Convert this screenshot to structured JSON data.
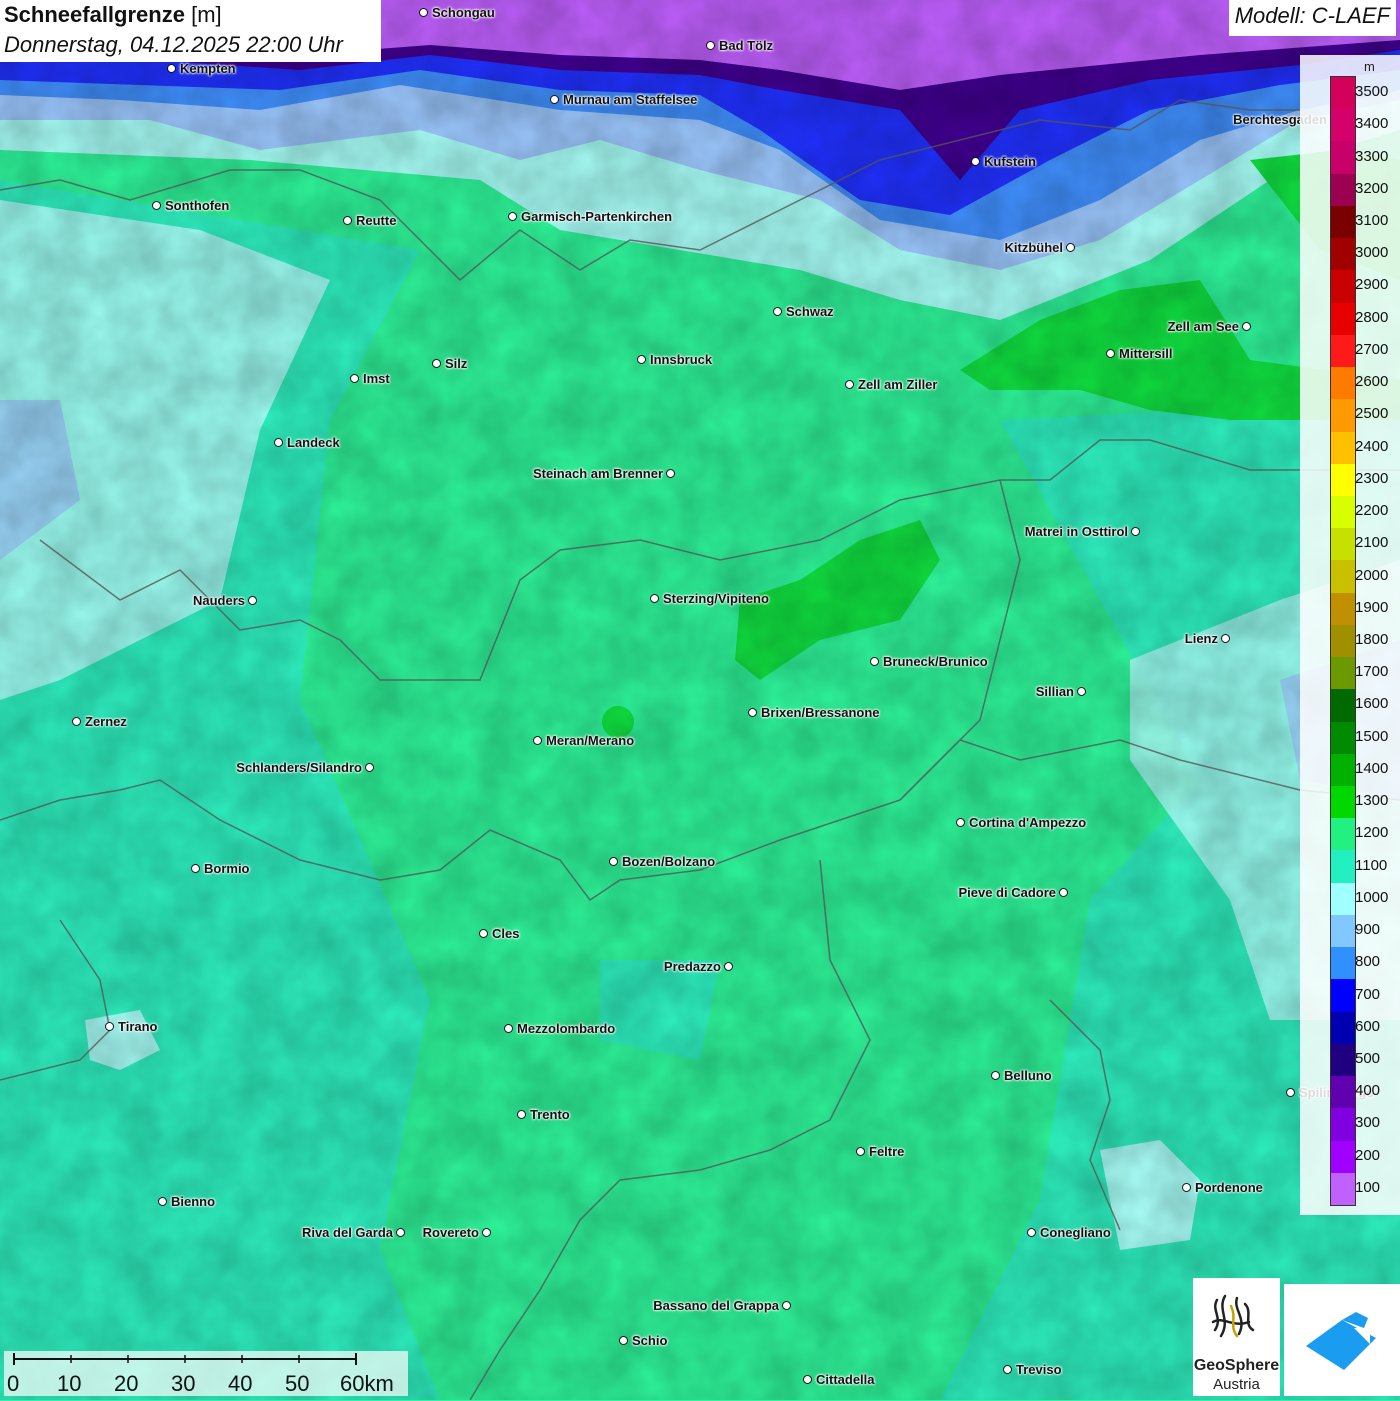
{
  "header": {
    "title": "Schneefallgrenze",
    "unit": "[m]",
    "datetime": "Donnerstag, 04.12.2025 22:00 Uhr",
    "model": "Modell: C-LAEF"
  },
  "legend": {
    "unit": "m",
    "entries": [
      {
        "label": "3500",
        "color": "#d4005a"
      },
      {
        "label": "3400",
        "color": "#d6006b"
      },
      {
        "label": "3300",
        "color": "#c8006a"
      },
      {
        "label": "3200",
        "color": "#9c0050"
      },
      {
        "label": "3100",
        "color": "#7a0000"
      },
      {
        "label": "3000",
        "color": "#a00000"
      },
      {
        "label": "2900",
        "color": "#c80000"
      },
      {
        "label": "2800",
        "color": "#e60000"
      },
      {
        "label": "2700",
        "color": "#ff1a1a"
      },
      {
        "label": "2600",
        "color": "#ff7a00"
      },
      {
        "label": "2500",
        "color": "#ff9a00"
      },
      {
        "label": "2400",
        "color": "#ffc000"
      },
      {
        "label": "2300",
        "color": "#ffff00"
      },
      {
        "label": "2200",
        "color": "#d8ff00"
      },
      {
        "label": "2100",
        "color": "#c8e000"
      },
      {
        "label": "2000",
        "color": "#c8c000"
      },
      {
        "label": "1900",
        "color": "#c09000"
      },
      {
        "label": "1800",
        "color": "#a09000"
      },
      {
        "label": "1700",
        "color": "#6a9a00"
      },
      {
        "label": "1600",
        "color": "#006a00"
      },
      {
        "label": "1500",
        "color": "#008a00"
      },
      {
        "label": "1400",
        "color": "#00b000"
      },
      {
        "label": "1300",
        "color": "#00d800"
      },
      {
        "label": "1200",
        "color": "#22f080"
      },
      {
        "label": "1100",
        "color": "#22f0c0"
      },
      {
        "label": "1000",
        "color": "#a0ffff"
      },
      {
        "label": "900",
        "color": "#80c8ff"
      },
      {
        "label": "800",
        "color": "#3090ff"
      },
      {
        "label": "700",
        "color": "#0000ff"
      },
      {
        "label": "600",
        "color": "#0000b0"
      },
      {
        "label": "500",
        "color": "#200080"
      },
      {
        "label": "400",
        "color": "#6000b0"
      },
      {
        "label": "300",
        "color": "#8000e0"
      },
      {
        "label": "200",
        "color": "#a000ff"
      },
      {
        "label": "100",
        "color": "#c060ff"
      }
    ]
  },
  "cities": [
    {
      "name": "Schongau",
      "side": "right"
    },
    {
      "name": "Bad Tölz",
      "side": "right"
    },
    {
      "name": "Kempten",
      "side": "right"
    },
    {
      "name": "Murnau am Staffelsee",
      "side": "right"
    },
    {
      "name": "Berchtesgaden",
      "side": "left"
    },
    {
      "name": "Kufstein",
      "side": "right"
    },
    {
      "name": "Sonthofen",
      "side": "right"
    },
    {
      "name": "Reutte",
      "side": "right"
    },
    {
      "name": "Garmisch-Partenkirchen",
      "side": "right"
    },
    {
      "name": "Kitzbühel",
      "side": "left"
    },
    {
      "name": "Schwaz",
      "side": "right"
    },
    {
      "name": "Zell am See",
      "side": "left"
    },
    {
      "name": "Innsbruck",
      "side": "right"
    },
    {
      "name": "Mittersill",
      "side": "right"
    },
    {
      "name": "Imst",
      "side": "right"
    },
    {
      "name": "Silz",
      "side": "right"
    },
    {
      "name": "Zell am Ziller",
      "side": "right"
    },
    {
      "name": "Landeck",
      "side": "right"
    },
    {
      "name": "Steinach am Brenner",
      "side": "left"
    },
    {
      "name": "Matrei in Osttirol",
      "side": "left"
    },
    {
      "name": "Nauders",
      "side": "left"
    },
    {
      "name": "Sterzing/Vipiteno",
      "side": "right"
    },
    {
      "name": "Lienz",
      "side": "left"
    },
    {
      "name": "Bruneck/Brunico",
      "side": "right"
    },
    {
      "name": "Sillian",
      "side": "left"
    },
    {
      "name": "Zernez",
      "side": "right"
    },
    {
      "name": "Brixen/Bressanone",
      "side": "right"
    },
    {
      "name": "Meran/Merano",
      "side": "right"
    },
    {
      "name": "Schlanders/Silandro",
      "side": "left"
    },
    {
      "name": "Cortina d'Ampezzo",
      "side": "right"
    },
    {
      "name": "Bormio",
      "side": "right"
    },
    {
      "name": "Bozen/Bolzano",
      "side": "right"
    },
    {
      "name": "Pieve di Cadore",
      "side": "left"
    },
    {
      "name": "Cles",
      "side": "right"
    },
    {
      "name": "Predazzo",
      "side": "left"
    },
    {
      "name": "Tirano",
      "side": "right"
    },
    {
      "name": "Mezzolombardo",
      "side": "right"
    },
    {
      "name": "Belluno",
      "side": "right"
    },
    {
      "name": "Spilimbergo",
      "side": "right"
    },
    {
      "name": "Trento",
      "side": "right"
    },
    {
      "name": "Feltre",
      "side": "right"
    },
    {
      "name": "Pordenone",
      "side": "right"
    },
    {
      "name": "Bienno",
      "side": "right"
    },
    {
      "name": "Riva del Garda",
      "side": "left"
    },
    {
      "name": "Rovereto",
      "side": "left"
    },
    {
      "name": "Conegliano",
      "side": "right"
    },
    {
      "name": "Bassano del Grappa",
      "side": "left"
    },
    {
      "name": "Schio",
      "side": "right"
    },
    {
      "name": "Treviso",
      "side": "right"
    },
    {
      "name": "Cittadella",
      "side": "right"
    }
  ],
  "scalebar": {
    "ticks": [
      "0",
      "10",
      "20",
      "30",
      "40",
      "50",
      "60km"
    ]
  },
  "logos": {
    "geosphere_line1": "GeoSphere",
    "geosphere_line2": "Austria"
  },
  "colors": {
    "band_1200": "#2ef59a",
    "band_1100": "#2ef0c0",
    "band_1000": "#a8fff8",
    "band_1300": "#10e040",
    "band_900": "#9cc8ff",
    "band_800": "#4090ff",
    "band_700": "#2030ff",
    "band_500": "#400090",
    "band_top": "#c060ff"
  }
}
